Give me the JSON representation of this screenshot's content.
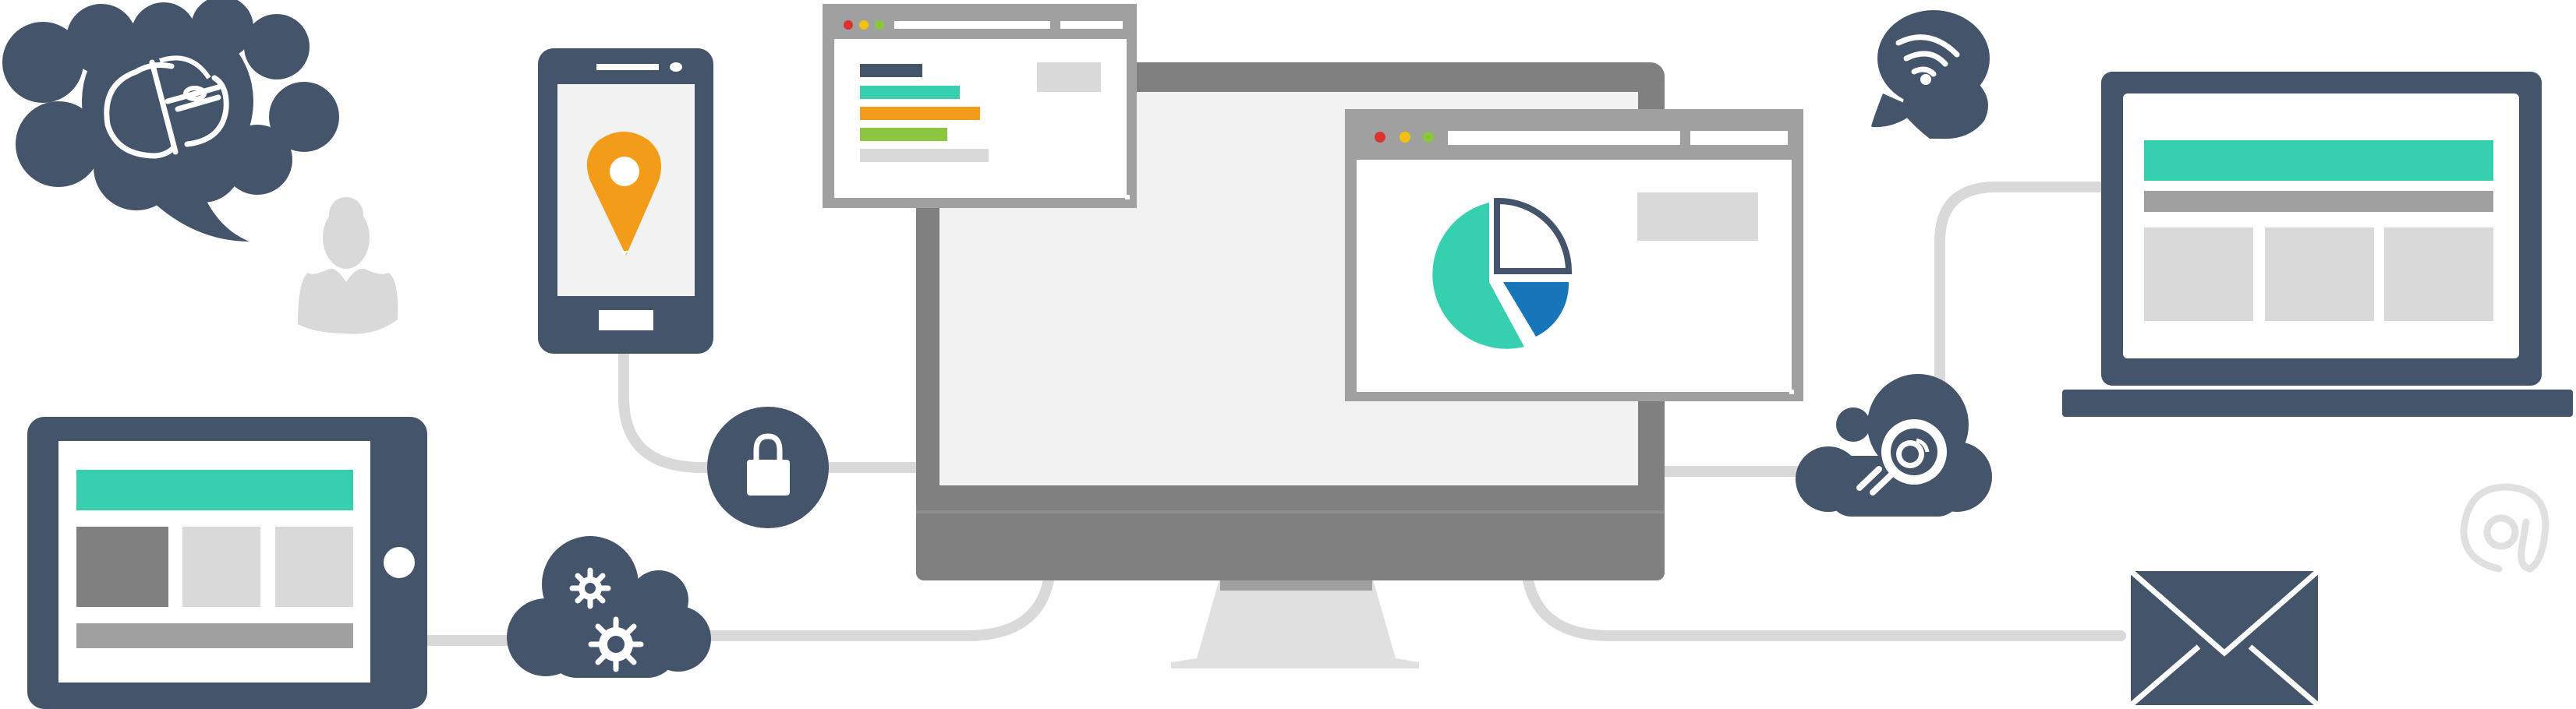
{
  "colors": {
    "navy": "#44546a",
    "teal": "#36d0b0",
    "orange": "#f39c19",
    "green": "#8cc63f",
    "blue": "#1676b8",
    "grey_dark": "#808080",
    "grey_mid": "#a0a0a0",
    "grey_light": "#d9d9d9",
    "screen_bg": "#f2f2f2",
    "dot_red": "#d9352e",
    "dot_yellow": "#f4c20d",
    "dot_green": "#8cc63f"
  },
  "icons": [
    "thought-cloud-icon",
    "user-silhouette-icon",
    "smartphone-icon",
    "location-pin-icon",
    "padlock-icon",
    "desktop-monitor-icon",
    "browser-window-icon",
    "pie-chart-icon",
    "speech-bubble-wifi-icon",
    "cloud-search-icon",
    "laptop-icon",
    "tablet-icon",
    "cloud-gears-icon",
    "envelope-icon",
    "at-sign-icon"
  ]
}
